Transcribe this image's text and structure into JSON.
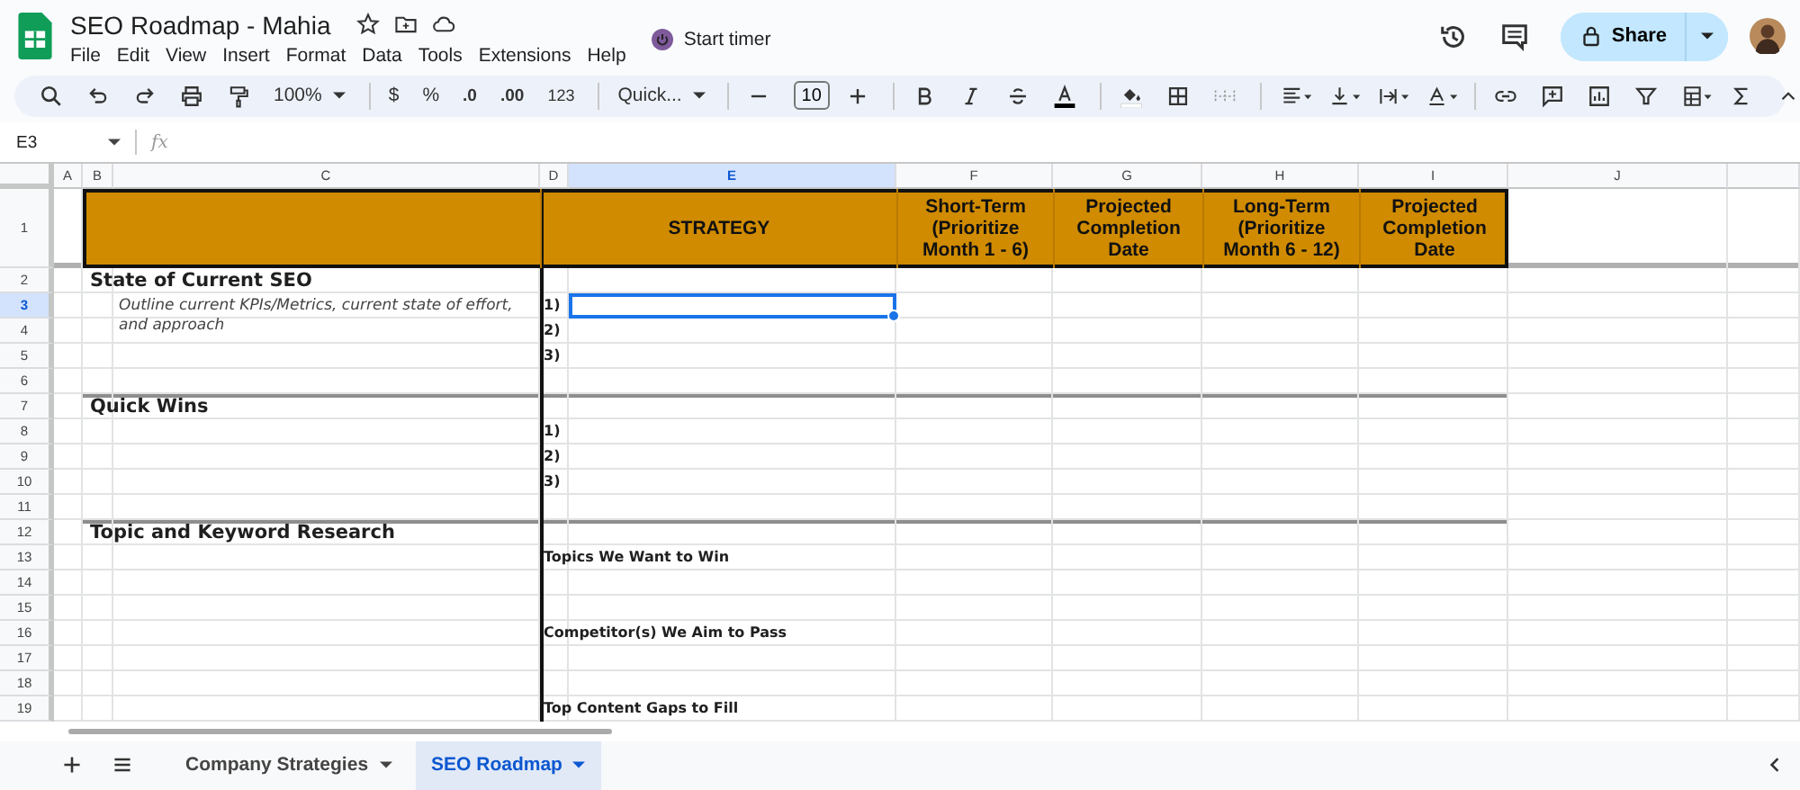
{
  "document": {
    "title": "SEO Roadmap - Mahia",
    "timer": "Start timer",
    "share": "Share"
  },
  "menu": [
    "File",
    "Edit",
    "View",
    "Insert",
    "Format",
    "Data",
    "Tools",
    "Extensions",
    "Help"
  ],
  "toolbar": {
    "zoom": "100%",
    "currency": "$",
    "percent": "%",
    "decrease_decimals": ".0",
    "increase_decimals": ".00",
    "number_format": "123",
    "font": "Quick...",
    "font_size": "10"
  },
  "formula_bar": {
    "name_box": "E3",
    "fx": "fx"
  },
  "columns": [
    {
      "label": "A",
      "selected": false
    },
    {
      "label": "B",
      "selected": false
    },
    {
      "label": "C",
      "selected": false
    },
    {
      "label": "D",
      "selected": false
    },
    {
      "label": "E",
      "selected": true
    },
    {
      "label": "F",
      "selected": false
    },
    {
      "label": "G",
      "selected": false
    },
    {
      "label": "H",
      "selected": false
    },
    {
      "label": "I",
      "selected": false
    },
    {
      "label": "J",
      "selected": false
    }
  ],
  "headers": [
    {
      "text": "STRATEGY"
    },
    {
      "text": "Short-Term (Prioritize Month 1 - 6)"
    },
    {
      "text": "Projected Completion Date"
    },
    {
      "text": "Long-Term (Prioritize Month 6 - 12)"
    },
    {
      "text": "Projected Completion Date"
    }
  ],
  "rows": [
    {
      "number": "1",
      "selected": false
    },
    {
      "number": "2",
      "selected": false,
      "texts": [
        {
          "kind": "section",
          "text": "State of Current SEO"
        }
      ]
    },
    {
      "number": "3",
      "selected": true,
      "texts": [
        {
          "kind": "note",
          "text": "Outline current KPIs/Metrics, current state of effort, and approach"
        },
        {
          "kind": "item",
          "text": "1)"
        }
      ]
    },
    {
      "number": "4",
      "selected": false,
      "texts": [
        {
          "kind": "item",
          "text": "2)"
        }
      ]
    },
    {
      "number": "5",
      "selected": false,
      "texts": [
        {
          "kind": "item",
          "text": "3)"
        }
      ]
    },
    {
      "number": "6",
      "selected": false
    },
    {
      "number": "7",
      "selected": false,
      "texts": [
        {
          "kind": "section",
          "text": "Quick Wins"
        }
      ]
    },
    {
      "number": "8",
      "selected": false,
      "texts": [
        {
          "kind": "item",
          "text": "1)"
        }
      ]
    },
    {
      "number": "9",
      "selected": false,
      "texts": [
        {
          "kind": "item",
          "text": "2)"
        }
      ]
    },
    {
      "number": "10",
      "selected": false,
      "texts": [
        {
          "kind": "item",
          "text": "3)"
        }
      ]
    },
    {
      "number": "11",
      "selected": false
    },
    {
      "number": "12",
      "selected": false,
      "texts": [
        {
          "kind": "section",
          "text": "Topic and Keyword Research"
        }
      ]
    },
    {
      "number": "13",
      "selected": false,
      "texts": [
        {
          "kind": "item",
          "text": "Topics We Want to Win"
        }
      ]
    },
    {
      "number": "14",
      "selected": false
    },
    {
      "number": "15",
      "selected": false
    },
    {
      "number": "16",
      "selected": false,
      "texts": [
        {
          "kind": "item",
          "text": "Competitor(s) We Aim to Pass"
        }
      ]
    },
    {
      "number": "17",
      "selected": false
    },
    {
      "number": "18",
      "selected": false
    },
    {
      "number": "19",
      "selected": false,
      "texts": [
        {
          "kind": "item",
          "text": "Top Content Gaps to Fill"
        }
      ]
    }
  ],
  "sheets": [
    {
      "name": "Company Strategies",
      "selected": false
    },
    {
      "name": "SEO Roadmap",
      "selected": true
    }
  ]
}
